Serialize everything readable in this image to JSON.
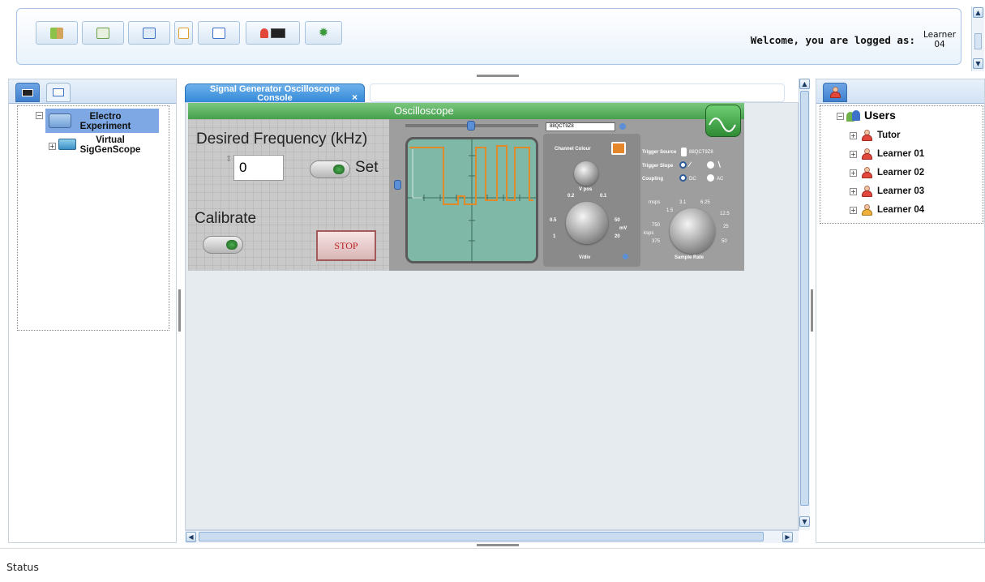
{
  "toolbar": {
    "buttons": [
      {
        "icon": "exit-icon",
        "color": "#5a9e3a"
      },
      {
        "icon": "save-icon",
        "color": "#5a9e3a"
      },
      {
        "icon": "load-icon",
        "color": "#3d72c8"
      },
      {
        "icon": "edit-icon",
        "color": "#e0a030"
      },
      {
        "icon": "window-icon",
        "color": "#3d72c8"
      },
      {
        "icon": "user-console-icon",
        "color": "#c0392b"
      },
      {
        "icon": "bug-icon",
        "color": "#4caf50"
      }
    ],
    "welcome_text": "Welcome, you are logged as:",
    "user_line1": "Learner",
    "user_line2": "04"
  },
  "left_panel": {
    "tabs": [
      "console-tab-icon",
      "panel-tab-icon"
    ],
    "tree": {
      "root_label_line1": "Electro",
      "root_label_line2": "Experiment",
      "child_label_line1": "Virtual",
      "child_label_line2": "SigGenScope"
    }
  },
  "center": {
    "tab_title_line1": "Signal Generator Oscilloscope",
    "tab_title_line2": "Console",
    "tab_close": "×",
    "vi": {
      "desired_frequency_label": "Desired Frequency (kHz)",
      "frequency_value": "0",
      "set_label": "Set",
      "calibrate_label": "Calibrate",
      "stop_label": "STOP",
      "oscilloscope_title": "Oscilloscope",
      "device_select": "88QCT9Z8",
      "channel_colour_label": "Channel Colour",
      "trigger_source_label": "Trigger Source",
      "trigger_source_value": "88QCT9Z8",
      "trigger_slope_label": "Trigger Slope",
      "coupling_label": "Coupling",
      "coupling_dc": "DC",
      "coupling_ac": "AC",
      "vpos_label": "V pos",
      "vpos_min": "0.2",
      "vpos_max": "0.1",
      "vdiv_label": "V/div",
      "vdiv_ticks": [
        "0.5",
        "1",
        "20",
        "50",
        "mV"
      ],
      "sample_rate_label": "Sample Rate",
      "sr_ticks": [
        "msps",
        "3.1",
        "6.25",
        "1.5",
        "12.5",
        "750",
        "25",
        "ksps",
        "375",
        "50"
      ]
    }
  },
  "right_panel": {
    "tab_icon": "users-tab-icon",
    "root_label": "Users",
    "users": [
      "Tutor",
      "Learner 01",
      "Learner 02",
      "Learner 03",
      "Learner 04"
    ]
  },
  "status": {
    "text": "Status"
  },
  "colors": {
    "accent": "#2f87d6",
    "panel_border": "#a7c4e4",
    "vi_green": "#45a04b",
    "scope_screen": "#7fb8a6",
    "trace": "#e08a2c"
  }
}
